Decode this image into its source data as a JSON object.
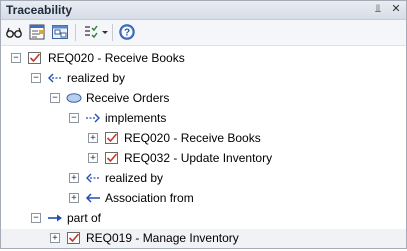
{
  "window": {
    "title": "Traceability",
    "pin_glyph": "⫫",
    "close_glyph": "✕"
  },
  "toolbar": {
    "items": [
      {
        "name": "glasses-icon"
      },
      {
        "name": "properties-icon"
      },
      {
        "name": "locate-in-browser-icon"
      },
      {
        "name": "filter-icon"
      },
      {
        "name": "dropdown-arrow-icon"
      },
      {
        "name": "help-icon"
      }
    ]
  },
  "tree": {
    "rows": [
      {
        "label": "REQ020 - Receive Books",
        "expander": "−",
        "icon": "requirement-icon"
      },
      {
        "label": "realized by",
        "expander": "−",
        "icon": "realization-arrow-icon"
      },
      {
        "label": "Receive Orders",
        "expander": "−",
        "icon": "use-case-icon"
      },
      {
        "label": "implements",
        "expander": "−",
        "icon": "realization-arrow-icon"
      },
      {
        "label": "REQ020 - Receive Books",
        "expander": "+",
        "icon": "requirement-icon"
      },
      {
        "label": "REQ032 - Update Inventory",
        "expander": "+",
        "icon": "requirement-icon"
      },
      {
        "label": "realized by",
        "expander": "+",
        "icon": "realization-arrow-icon"
      },
      {
        "label": "Association from",
        "expander": "+",
        "icon": "association-arrow-icon"
      },
      {
        "label": "part of",
        "expander": "−",
        "icon": "aggregation-arrow-icon"
      },
      {
        "label": "REQ019 - Manage Inventory",
        "expander": "+",
        "icon": "requirement-icon"
      }
    ]
  },
  "colors": {
    "title_bg_top": "#e9edf3",
    "title_bg_bottom": "#d6dde7",
    "arrow_blue": "#1f4fb5",
    "req_red": "#c0392b"
  }
}
